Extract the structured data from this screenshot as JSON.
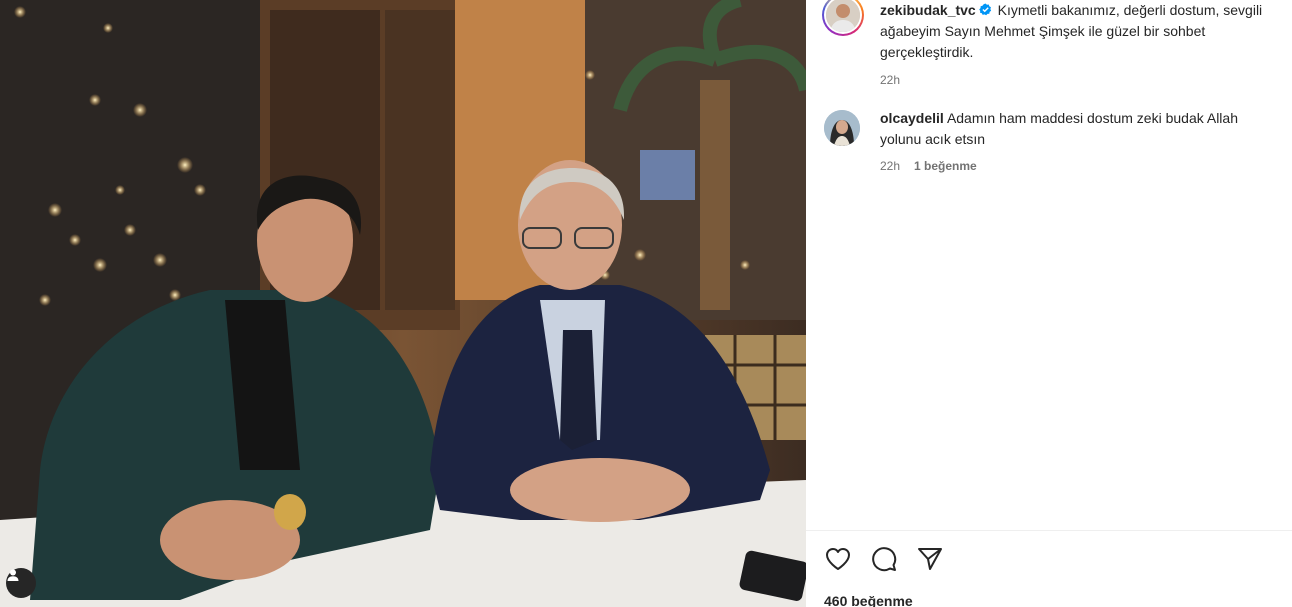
{
  "post": {
    "username": "zekibudak_tvc",
    "caption_line1": "Kıymetli bakanımız, değerli dostum, sevgili",
    "caption_line2": "ağabeyim Sayın Mehmet Şimşek ile güzel bir sohbet",
    "caption_line3": "gerçekleştirdik.",
    "time": "22h",
    "verified_icon": "verified-badge-icon",
    "accent_color": "#0095f6"
  },
  "comments": [
    {
      "username": "olcaydelil",
      "text_line1": "Adamın ham maddesi dostum zeki budak Allah",
      "text_line2": "yolunu acık etsın",
      "time": "22h",
      "likes": "1 beğenme"
    }
  ],
  "actions": {
    "like_icon": "heart-icon",
    "comment_icon": "comment-icon",
    "share_icon": "send-icon"
  },
  "likes_count": "460 beğenme",
  "photo": {
    "tag_icon": "user-tag-icon"
  }
}
